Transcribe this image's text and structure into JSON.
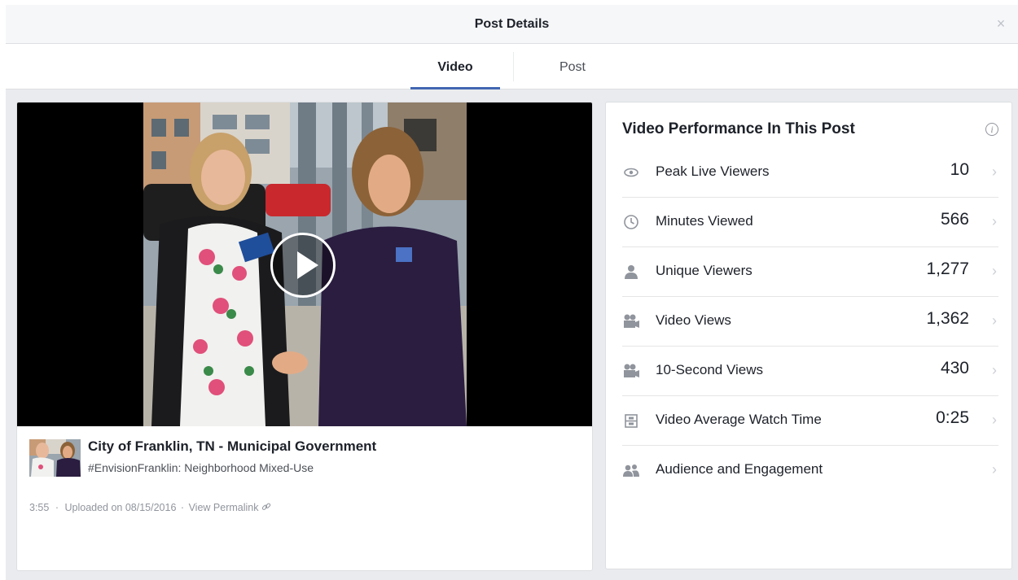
{
  "dialog": {
    "title": "Post Details",
    "close_glyph": "×"
  },
  "tabs": [
    {
      "label": "Video",
      "active": true
    },
    {
      "label": "Post",
      "active": false
    }
  ],
  "video": {
    "page_name": "City of Franklin, TN - Municipal Government",
    "description": "#EnvisionFranklin: Neighborhood Mixed-Use",
    "duration": "3:55",
    "separator": "·",
    "uploaded": "Uploaded on 08/15/2016",
    "permalink": "View Permalink"
  },
  "performance": {
    "title": "Video Performance In This Post",
    "info_glyph": "i",
    "metrics": [
      {
        "icon": "eye-icon",
        "label": "Peak Live Viewers",
        "value": "10"
      },
      {
        "icon": "clock-icon",
        "label": "Minutes Viewed",
        "value": "566"
      },
      {
        "icon": "person-icon",
        "label": "Unique Viewers",
        "value": "1,277"
      },
      {
        "icon": "video-camera-icon",
        "label": "Video Views",
        "value": "1,362"
      },
      {
        "icon": "video-camera-icon",
        "label": "10-Second Views",
        "value": "430"
      },
      {
        "icon": "film-icon",
        "label": "Video Average Watch Time",
        "value": "0:25"
      },
      {
        "icon": "people-icon",
        "label": "Audience and Engagement",
        "value": ""
      }
    ],
    "chevron_glyph": "›"
  },
  "colors": {
    "accent": "#4267b2",
    "background": "#e9ebee",
    "text": "#1d2129",
    "muted": "#90949c"
  }
}
